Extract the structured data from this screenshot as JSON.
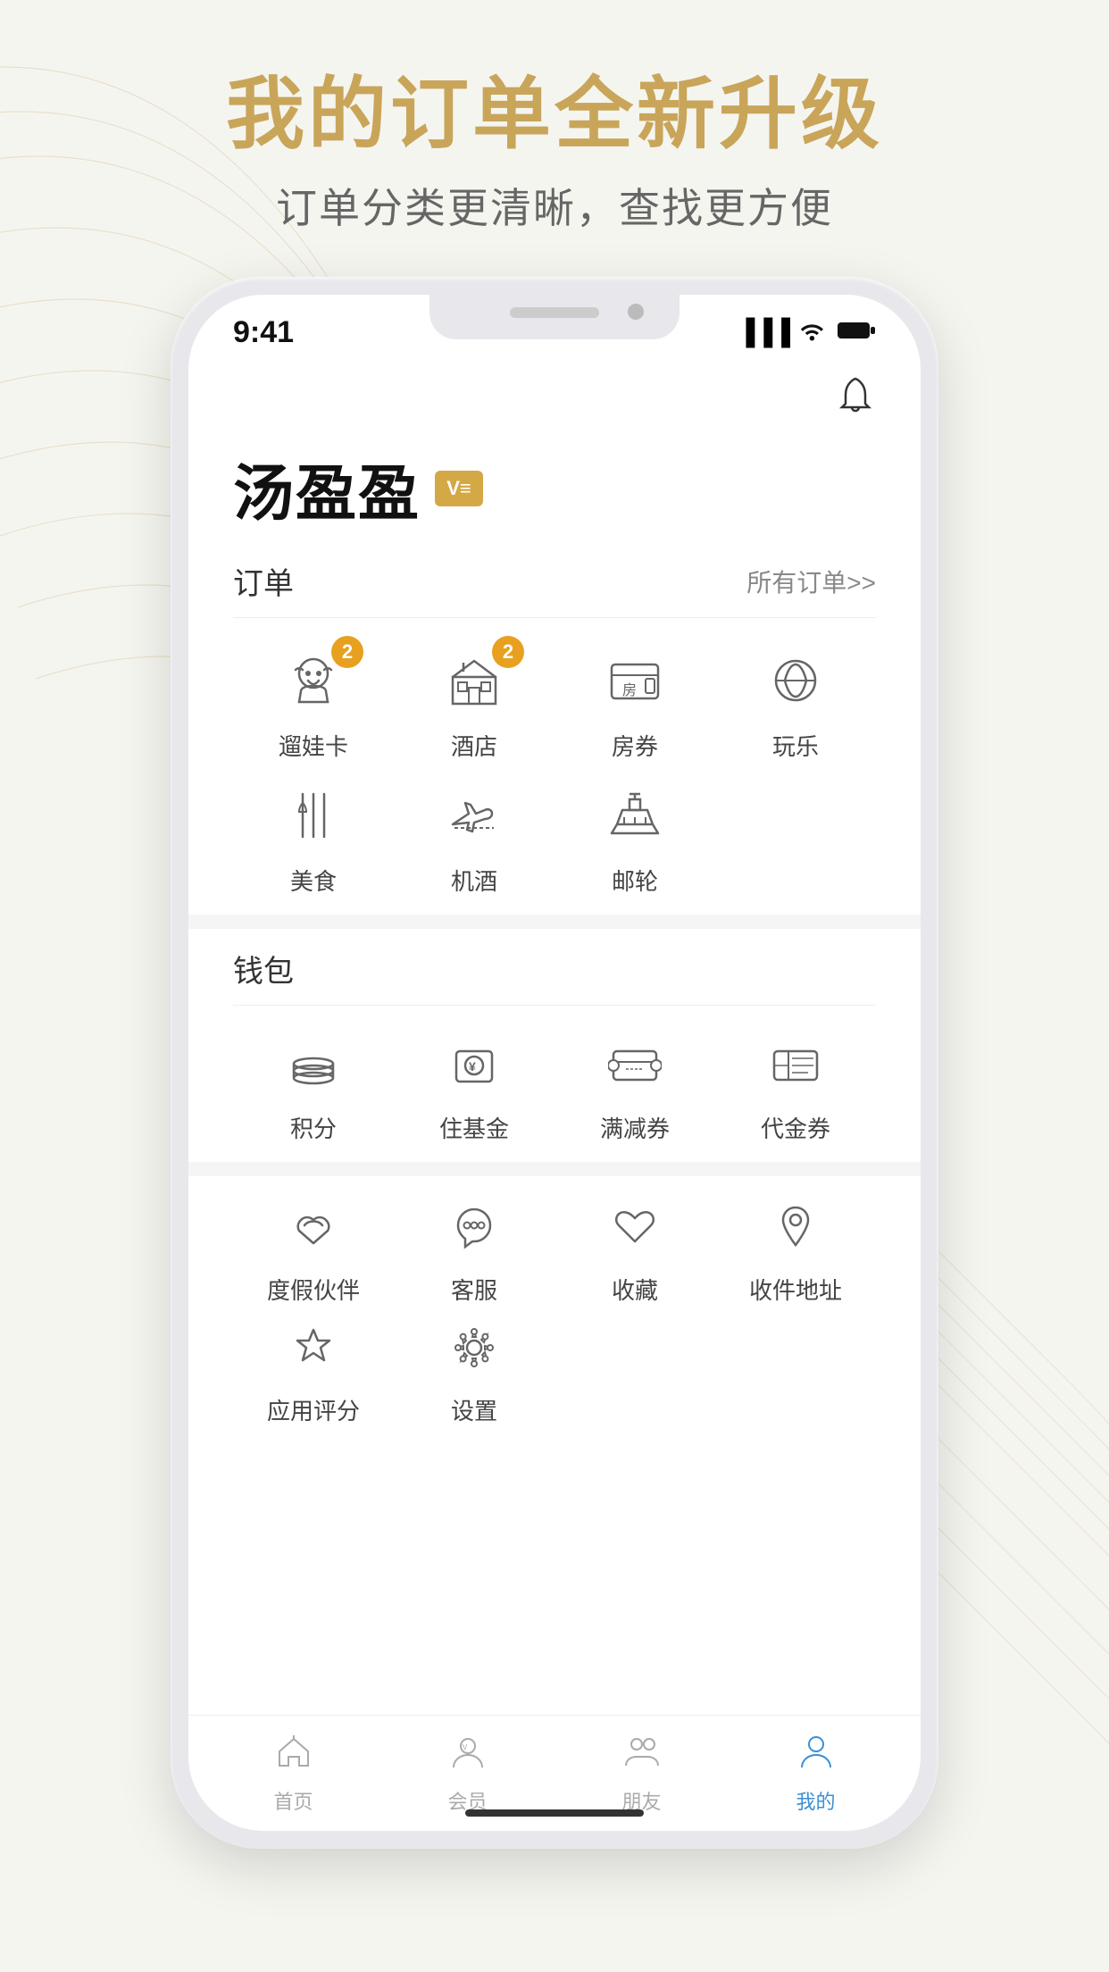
{
  "background": {
    "color": "#f2f0ea"
  },
  "header": {
    "title": "我的订单全新升级",
    "subtitle": "订单分类更清晰，查找更方便"
  },
  "status_bar": {
    "time": "9:41"
  },
  "app": {
    "user_name": "汤盈盈",
    "vip_badge": "V≡",
    "bell_label": "notification",
    "order_section": {
      "title": "订单",
      "link": "所有订单>>"
    },
    "orders": [
      {
        "label": "遛娃卡",
        "badge": 2,
        "has_badge": true
      },
      {
        "label": "酒店",
        "badge": 2,
        "has_badge": true
      },
      {
        "label": "房券",
        "badge": 0,
        "has_badge": false
      },
      {
        "label": "玩乐",
        "badge": 0,
        "has_badge": false
      },
      {
        "label": "美食",
        "badge": 0,
        "has_badge": false
      },
      {
        "label": "机酒",
        "badge": 0,
        "has_badge": false
      },
      {
        "label": "邮轮",
        "badge": 0,
        "has_badge": false
      }
    ],
    "wallet_section": {
      "title": "钱包"
    },
    "wallet_items": [
      {
        "label": "积分"
      },
      {
        "label": "住基金"
      },
      {
        "label": "满减券"
      },
      {
        "label": "代金券"
      }
    ],
    "services": [
      {
        "label": "度假伙伴"
      },
      {
        "label": "客服"
      },
      {
        "label": "收藏"
      },
      {
        "label": "收件地址"
      },
      {
        "label": "应用评分"
      },
      {
        "label": "设置"
      }
    ],
    "bottom_nav": [
      {
        "label": "首页",
        "active": false
      },
      {
        "label": "会员",
        "active": false
      },
      {
        "label": "朋友",
        "active": false
      },
      {
        "label": "我的",
        "active": true
      }
    ]
  }
}
